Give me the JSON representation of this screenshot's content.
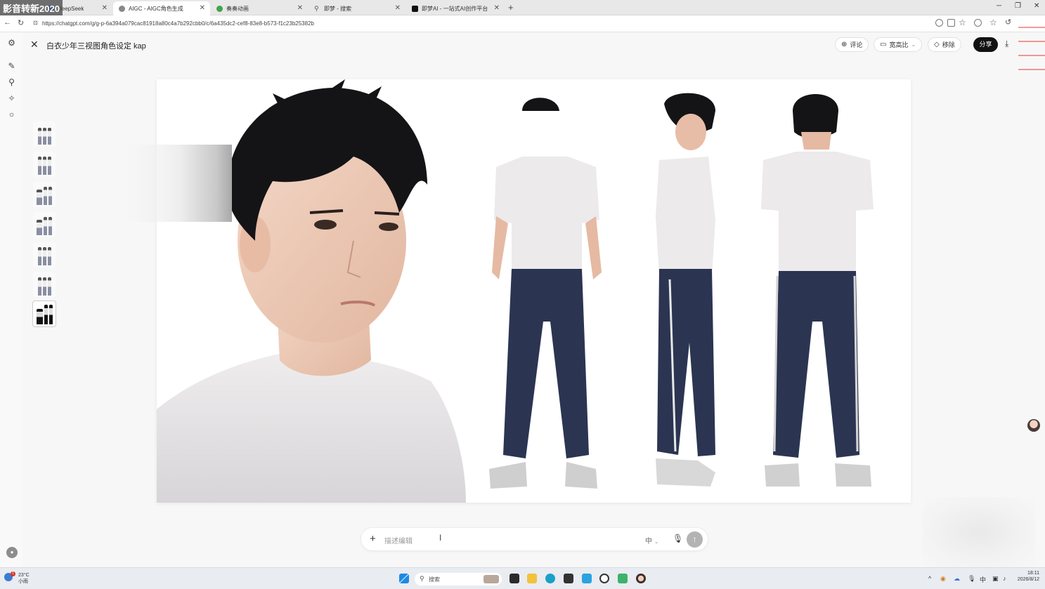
{
  "watermark": "影音转新2020",
  "tabs": [
    {
      "title": "DeepSeek",
      "icon": "deepseek-icon",
      "active": false
    },
    {
      "title": "AIGC - AIGC角色生成",
      "icon": "chatgpt-icon",
      "active": true
    },
    {
      "title": "奏奏动画",
      "icon": "leaf-icon",
      "active": false
    },
    {
      "title": "即梦 - 搜索",
      "icon": "search-icon",
      "active": false
    },
    {
      "title": "即梦AI - 一站式AI创作平台",
      "icon": "jimeng-icon",
      "active": false
    }
  ],
  "new_tab": "+",
  "window": {
    "minimize": "─",
    "restore": "❐",
    "close": "✕"
  },
  "address": {
    "url": "https://chatgpt.com/g/g-p-6a394a079cac81918a80c4a7b292cbb0/c/6a435dc2-cef8-83e8-b573-f1c23b25382b"
  },
  "viewer": {
    "title": "白衣少年三视图角色设定 kap",
    "buttons": {
      "comment": "评论",
      "aspect": "宽高比",
      "remove": "移除",
      "share": "分享"
    }
  },
  "thumbnails": [
    "1",
    "2",
    "3",
    "4",
    "5",
    "6",
    "7"
  ],
  "selected_thumbnail_index": 6,
  "composer": {
    "plus": "+",
    "placeholder": "描述编辑",
    "cursor": "I",
    "ime": "中",
    "send": "↑"
  },
  "taskbar": {
    "weather_temp": "23°C",
    "weather_desc": "小雨",
    "weather_badge": "1",
    "search_label": "搜索",
    "tray_ime": "中",
    "time": "18:11",
    "date": "2026/8/12"
  },
  "colors": {
    "accent": "#111111",
    "send_disabled": "#b3b3b3",
    "taskbar": "#e9ecf1"
  }
}
